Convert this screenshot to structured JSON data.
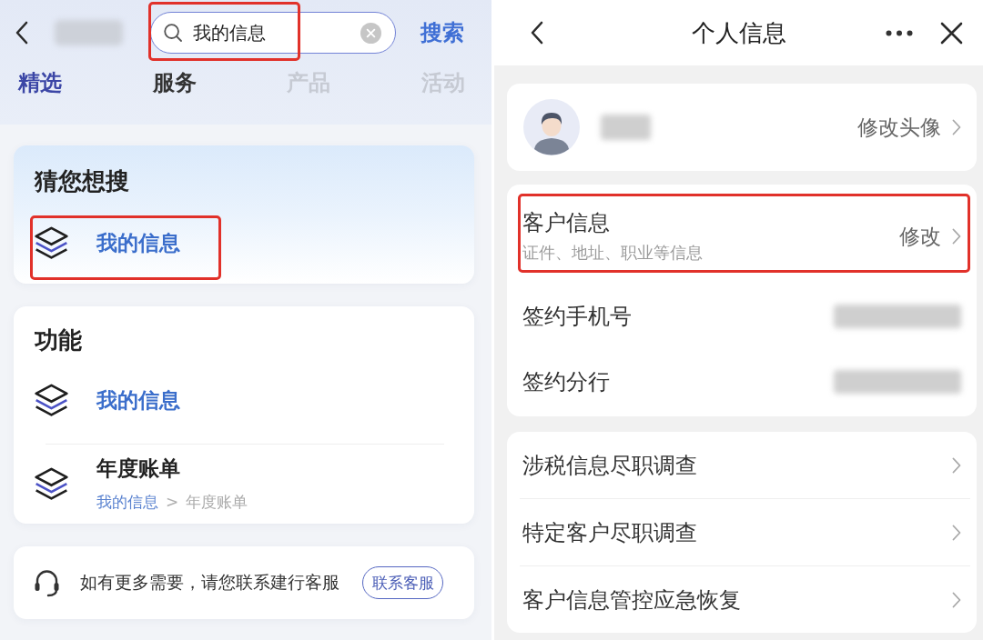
{
  "search_screen": {
    "logo_blurred": true,
    "search": {
      "value": "我的信息",
      "highlighted": true
    },
    "search_button": "搜索",
    "tabs": [
      {
        "label": "精选",
        "selected": true,
        "faded": false
      },
      {
        "label": "服务",
        "selected": false,
        "faded": false
      },
      {
        "label": "产品",
        "selected": false,
        "faded": true
      },
      {
        "label": "活动",
        "selected": false,
        "faded": true
      }
    ],
    "suggestions": {
      "title": "猜您想搜",
      "items": [
        {
          "label": "我的信息",
          "matched": true,
          "highlighted": true
        }
      ]
    },
    "functions": {
      "title": "功能",
      "items": [
        {
          "label": "我的信息",
          "matched": true
        },
        {
          "label": "年度账单",
          "matched": false,
          "path": [
            {
              "text": "我的信息",
              "matched": true
            },
            {
              "text": "年度账单",
              "matched": false
            }
          ],
          "path_separator": ">"
        }
      ]
    },
    "help": {
      "text": "如有更多需要，请您联系建行客服",
      "button": "联系客服"
    }
  },
  "info_screen": {
    "title": "个人信息",
    "profile": {
      "name_blurred": true,
      "action": "修改头像"
    },
    "details": [
      {
        "kind": "editable",
        "label": "客户信息",
        "sublabel": "证件、地址、职业等信息",
        "action": "修改",
        "highlighted": true
      },
      {
        "kind": "value",
        "label": "签约手机号",
        "value_blurred": true,
        "highlighted": false
      },
      {
        "kind": "value",
        "label": "签约分行",
        "value_blurred": true,
        "highlighted": false
      }
    ],
    "links": [
      {
        "label": "涉税信息尽职调查"
      },
      {
        "label": "特定客户尽职调查"
      },
      {
        "label": "客户信息管控应急恢复"
      }
    ]
  }
}
